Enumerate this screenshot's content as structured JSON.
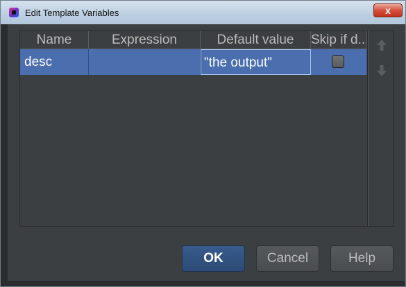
{
  "window": {
    "title": "Edit Template Variables",
    "close_glyph": "x"
  },
  "table": {
    "columns": [
      "Name",
      "Expression",
      "Default value",
      "Skip if d..."
    ],
    "rows": [
      {
        "name": "desc",
        "expression": "",
        "default_value": "\"the output\"",
        "skip_if_defined": false
      }
    ]
  },
  "side_buttons": {
    "up": "arrow-up-icon",
    "down": "arrow-down-icon"
  },
  "buttons": {
    "ok": "OK",
    "cancel": "Cancel",
    "help": "Help"
  },
  "colors": {
    "selection": "#4b6eaf",
    "background": "#3c3f41",
    "ok_button": "#2c4a75"
  }
}
